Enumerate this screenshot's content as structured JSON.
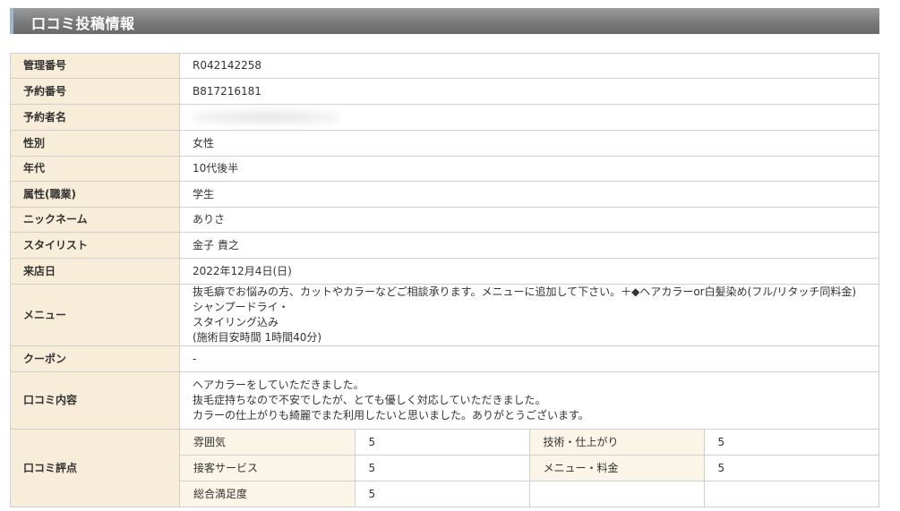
{
  "header": {
    "title": "口コミ投稿情報"
  },
  "rows": {
    "admin_no": {
      "label": "管理番号",
      "value": "R042142258"
    },
    "booking_no": {
      "label": "予約番号",
      "value": "B817216181"
    },
    "booker_name": {
      "label": "予約者名",
      "value": ""
    },
    "gender": {
      "label": "性別",
      "value": "女性"
    },
    "age": {
      "label": "年代",
      "value": "10代後半"
    },
    "occupation": {
      "label": "属性(職業)",
      "value": "学生"
    },
    "nickname": {
      "label": "ニックネーム",
      "value": "ありさ"
    },
    "stylist": {
      "label": "スタイリスト",
      "value": "金子 貴之"
    },
    "visit_date": {
      "label": "来店日",
      "value": "2022年12月4日(日)"
    },
    "menu": {
      "label": "メニュー",
      "lines": [
        "抜毛癖でお悩みの方、カットやカラーなどご相談承ります。メニューに追加して下さい。＋◆ヘアカラーor白髪染め(フル/リタッチ同料金)シャンプードライ・",
        "スタイリング込み",
        "(施術目安時間 1時間40分)"
      ]
    },
    "coupon": {
      "label": "クーポン",
      "value": "-"
    },
    "review": {
      "label": "口コミ内容",
      "lines": [
        "ヘアカラーをしていただきました。",
        "抜毛症持ちなので不安でしたが、とても優しく対応していただきました。",
        "カラーの仕上がりも綺麗でまた利用したいと思いました。ありがとうございます。"
      ]
    },
    "rating": {
      "label": "口コミ評点",
      "scores": [
        {
          "label": "雰囲気",
          "value": "5"
        },
        {
          "label": "技術・仕上がり",
          "value": "5"
        },
        {
          "label": "接客サービス",
          "value": "5"
        },
        {
          "label": "メニュー・料金",
          "value": "5"
        },
        {
          "label": "総合満足度",
          "value": "5"
        }
      ]
    }
  }
}
